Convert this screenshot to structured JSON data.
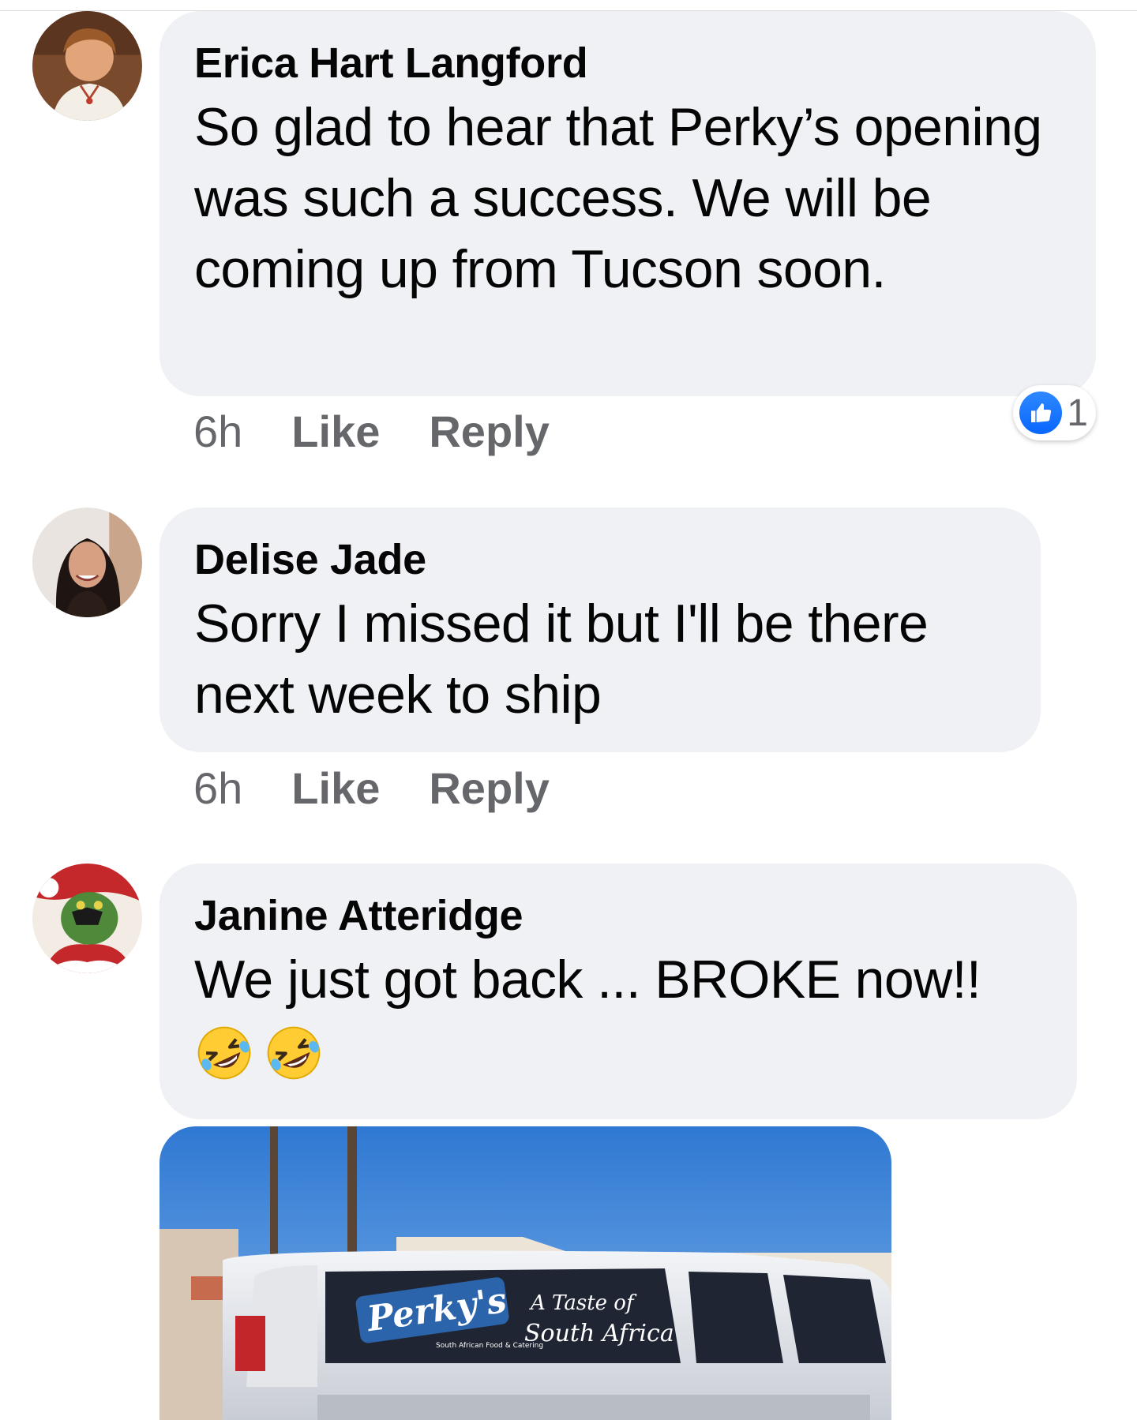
{
  "comments": [
    {
      "author": "Erica Hart Langford",
      "text": "So glad to hear that Perky’s opening was such a success.  We will be coming up from Tucson soon.",
      "time": "6h",
      "like_label": "Like",
      "reply_label": "Reply",
      "reaction_count": "1",
      "reaction_icon": "like-thumb-icon"
    },
    {
      "author": "Delise Jade",
      "text": "Sorry I missed it but I'll be there next week to ship",
      "time": "6h",
      "like_label": "Like",
      "reply_label": "Reply"
    },
    {
      "author": "Janine Atteridge",
      "text": "We just got back ... BROKE now!!",
      "emoji": [
        "rolling-on-floor-laughing-emoji",
        "rolling-on-floor-laughing-emoji"
      ],
      "photo": {
        "logo_text": "Perky's",
        "logo_subtext": "South African Food & Catering",
        "tagline_line1": "A Taste of",
        "tagline_line2": "South Africa"
      }
    }
  ],
  "colors": {
    "bubble": "#f0f1f4",
    "meta_text": "#65676b",
    "like_blue": "#0866ff"
  }
}
